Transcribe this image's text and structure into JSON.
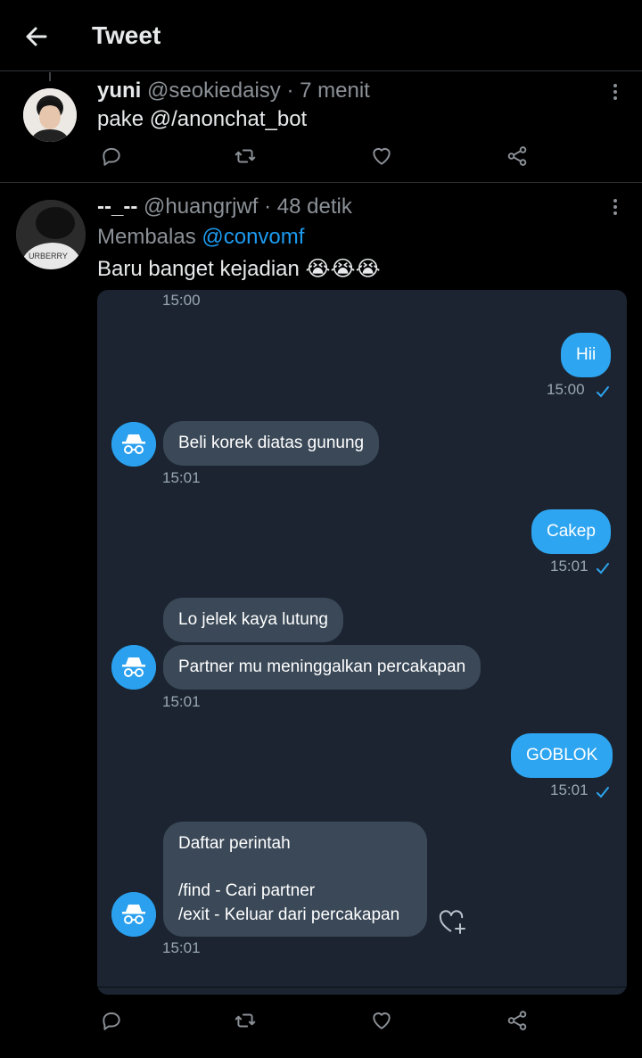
{
  "header": {
    "title": "Tweet"
  },
  "tweet1": {
    "name": "yuni",
    "handle_time": "@seokiedaisy · 7 menit",
    "text": "pake @/anonchat_bot"
  },
  "tweet2": {
    "name": "--_--",
    "handle_time": "@huangrjwf · 48 detik",
    "reply_prefix": "Membalas ",
    "reply_mention": "@convomf",
    "text": "Baru banget kejadian 😭😭😭"
  },
  "chat": {
    "top_time": "15:00",
    "messages": [
      {
        "dir": "out",
        "text": "Hii",
        "time": "15:00"
      },
      {
        "dir": "in",
        "text": "Beli korek diatas gunung",
        "time": "15:01"
      },
      {
        "dir": "out",
        "text": "Cakep",
        "time": "15:01"
      },
      {
        "dir": "in",
        "text": "Lo jelek kaya lutung"
      },
      {
        "dir": "in",
        "text": "Partner mu meninggalkan percakapan",
        "time": "15:01"
      },
      {
        "dir": "out",
        "text": "GOBLOK",
        "time": "15:01"
      },
      {
        "dir": "in",
        "text": "Daftar perintah\n\n/find - Cari partner\n/exit - Keluar dari percakapan",
        "time": "15:01"
      }
    ]
  },
  "icons": {
    "back": "arrow-left-icon",
    "more": "more-vertical-icon",
    "reply": "comment-icon",
    "retweet": "retweet-icon",
    "like": "heart-icon",
    "share": "share-icon",
    "bot": "incognito-icon",
    "react": "heart-plus-icon"
  },
  "colors": {
    "background": "#000000",
    "accent": "#1d9bf0",
    "outgoing_bubble": "#2ea5f0",
    "incoming_bubble": "#3a4857",
    "chat_background": "#1b2430"
  }
}
